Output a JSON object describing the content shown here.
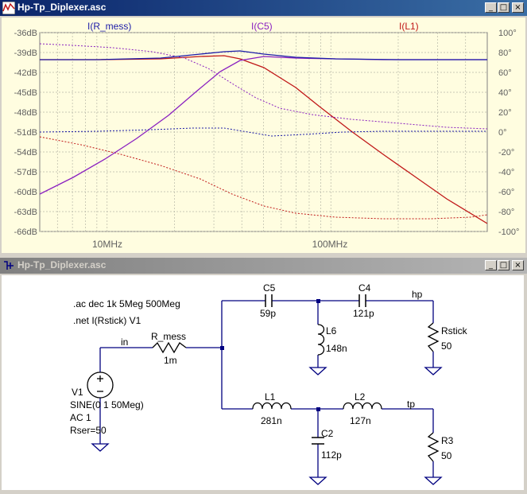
{
  "plot_window": {
    "title": "Hp-Tp_Diplexer.asc",
    "buttons": {
      "minimize": "_",
      "maximize": "□",
      "close": "×"
    },
    "traces": [
      {
        "label": "I(R_mess)",
        "color": "#1c1ca8"
      },
      {
        "label": "I(C5)",
        "color": "#8a20c0"
      },
      {
        "label": "I(L1)",
        "color": "#c01818"
      }
    ],
    "left_axis": [
      "-36dB",
      "-39dB",
      "-42dB",
      "-45dB",
      "-48dB",
      "-51dB",
      "-54dB",
      "-57dB",
      "-60dB",
      "-63dB",
      "-66dB"
    ],
    "right_axis": [
      "100°",
      "80°",
      "60°",
      "40°",
      "20°",
      "0°",
      "-20°",
      "-40°",
      "-60°",
      "-80°",
      "-100°"
    ],
    "x_axis": [
      "10MHz",
      "100MHz"
    ],
    "colors": {
      "background": "#fffde0",
      "grid": "#b8b8a8"
    }
  },
  "chart_data": {
    "type": "line",
    "title": "",
    "x_scale": "log",
    "xlim": [
      "5MHz",
      "500MHz"
    ],
    "ylim_left_dB": [
      -66,
      -36
    ],
    "ylim_right_deg": [
      -100,
      100
    ],
    "x_tick_labels": [
      "10MHz",
      "100MHz"
    ],
    "series": [
      {
        "name": "I(R_mess)",
        "color": "#1c1ca8",
        "magnitude_dB": "≈ -40 dB flat, slight rise near 27MHz",
        "phase_deg": "≈ 0° nearly flat"
      },
      {
        "name": "I(C5)",
        "color": "#8a20c0",
        "magnitude_dB": "rises from -60 dB at 5MHz to ≈ -40 dB above 30MHz",
        "phase_deg": "≈ 90° at 5MHz falling to ≈ 0° at 500MHz"
      },
      {
        "name": "I(L1)",
        "color": "#c01818",
        "magnitude_dB": "≈ -40 dB up to 30MHz, then falls to ≈ -65 dB at 500MHz",
        "phase_deg": "≈ 0° at 5MHz falling to ≈ -85° at 500MHz"
      }
    ]
  },
  "schematic_window": {
    "title": "Hp-Tp_Diplexer.asc",
    "buttons": {
      "minimize": "_",
      "maximize": "□",
      "close": "×"
    },
    "directives": [
      ".ac dec 1k 5Meg 500Meg",
      ".net I(Rstick) V1"
    ],
    "nets": {
      "in": "in",
      "hp": "hp",
      "tp": "tp"
    },
    "components": {
      "R_mess": {
        "name": "R_mess",
        "value": "1m"
      },
      "C5": {
        "name": "C5",
        "value": "59p"
      },
      "C4": {
        "name": "C4",
        "value": "121p"
      },
      "L6": {
        "name": "L6",
        "value": "148n"
      },
      "Rstick": {
        "name": "Rstick",
        "value": "50"
      },
      "L1": {
        "name": "L1",
        "value": "281n"
      },
      "L2": {
        "name": "L2",
        "value": "127n"
      },
      "C2": {
        "name": "C2",
        "value": "112p"
      },
      "R3": {
        "name": "R3",
        "value": "50"
      },
      "V1": {
        "name": "V1",
        "value1": "SINE(0 1 50Meg)",
        "value2": "AC 1",
        "value3": "Rser=50"
      }
    }
  }
}
